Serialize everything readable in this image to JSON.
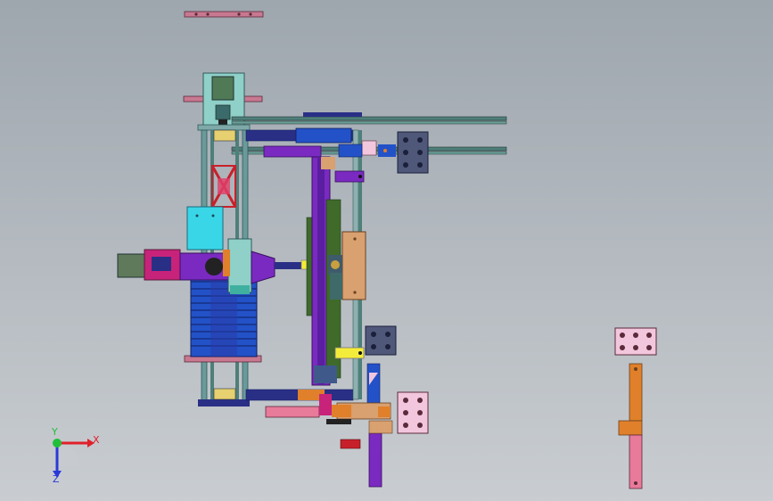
{
  "viewport": {
    "background_top": "#9ea6ae",
    "background_bottom": "#c9cdd1"
  },
  "triad": {
    "x_label": "X",
    "y_label": "Y",
    "z_label": "Z",
    "x_color": "#e0202a",
    "y_color": "#1fbf3a",
    "z_color": "#2a3ad8"
  },
  "palette": {
    "frame": "#5f8f8f",
    "rail": "#4f7f7a",
    "navy": "#2a2f86",
    "blue": "#2352c8",
    "cyan": "#39d6e8",
    "purple": "#7a2ac0",
    "magenta": "#c8237a",
    "orange": "#e0802a",
    "tan": "#d9a070",
    "pink": "#e87a9a",
    "yellow": "#f4ec3a",
    "olive": "#3f6a2a",
    "gray_block": "#50587a",
    "pink_block": "#f2c6dc"
  }
}
